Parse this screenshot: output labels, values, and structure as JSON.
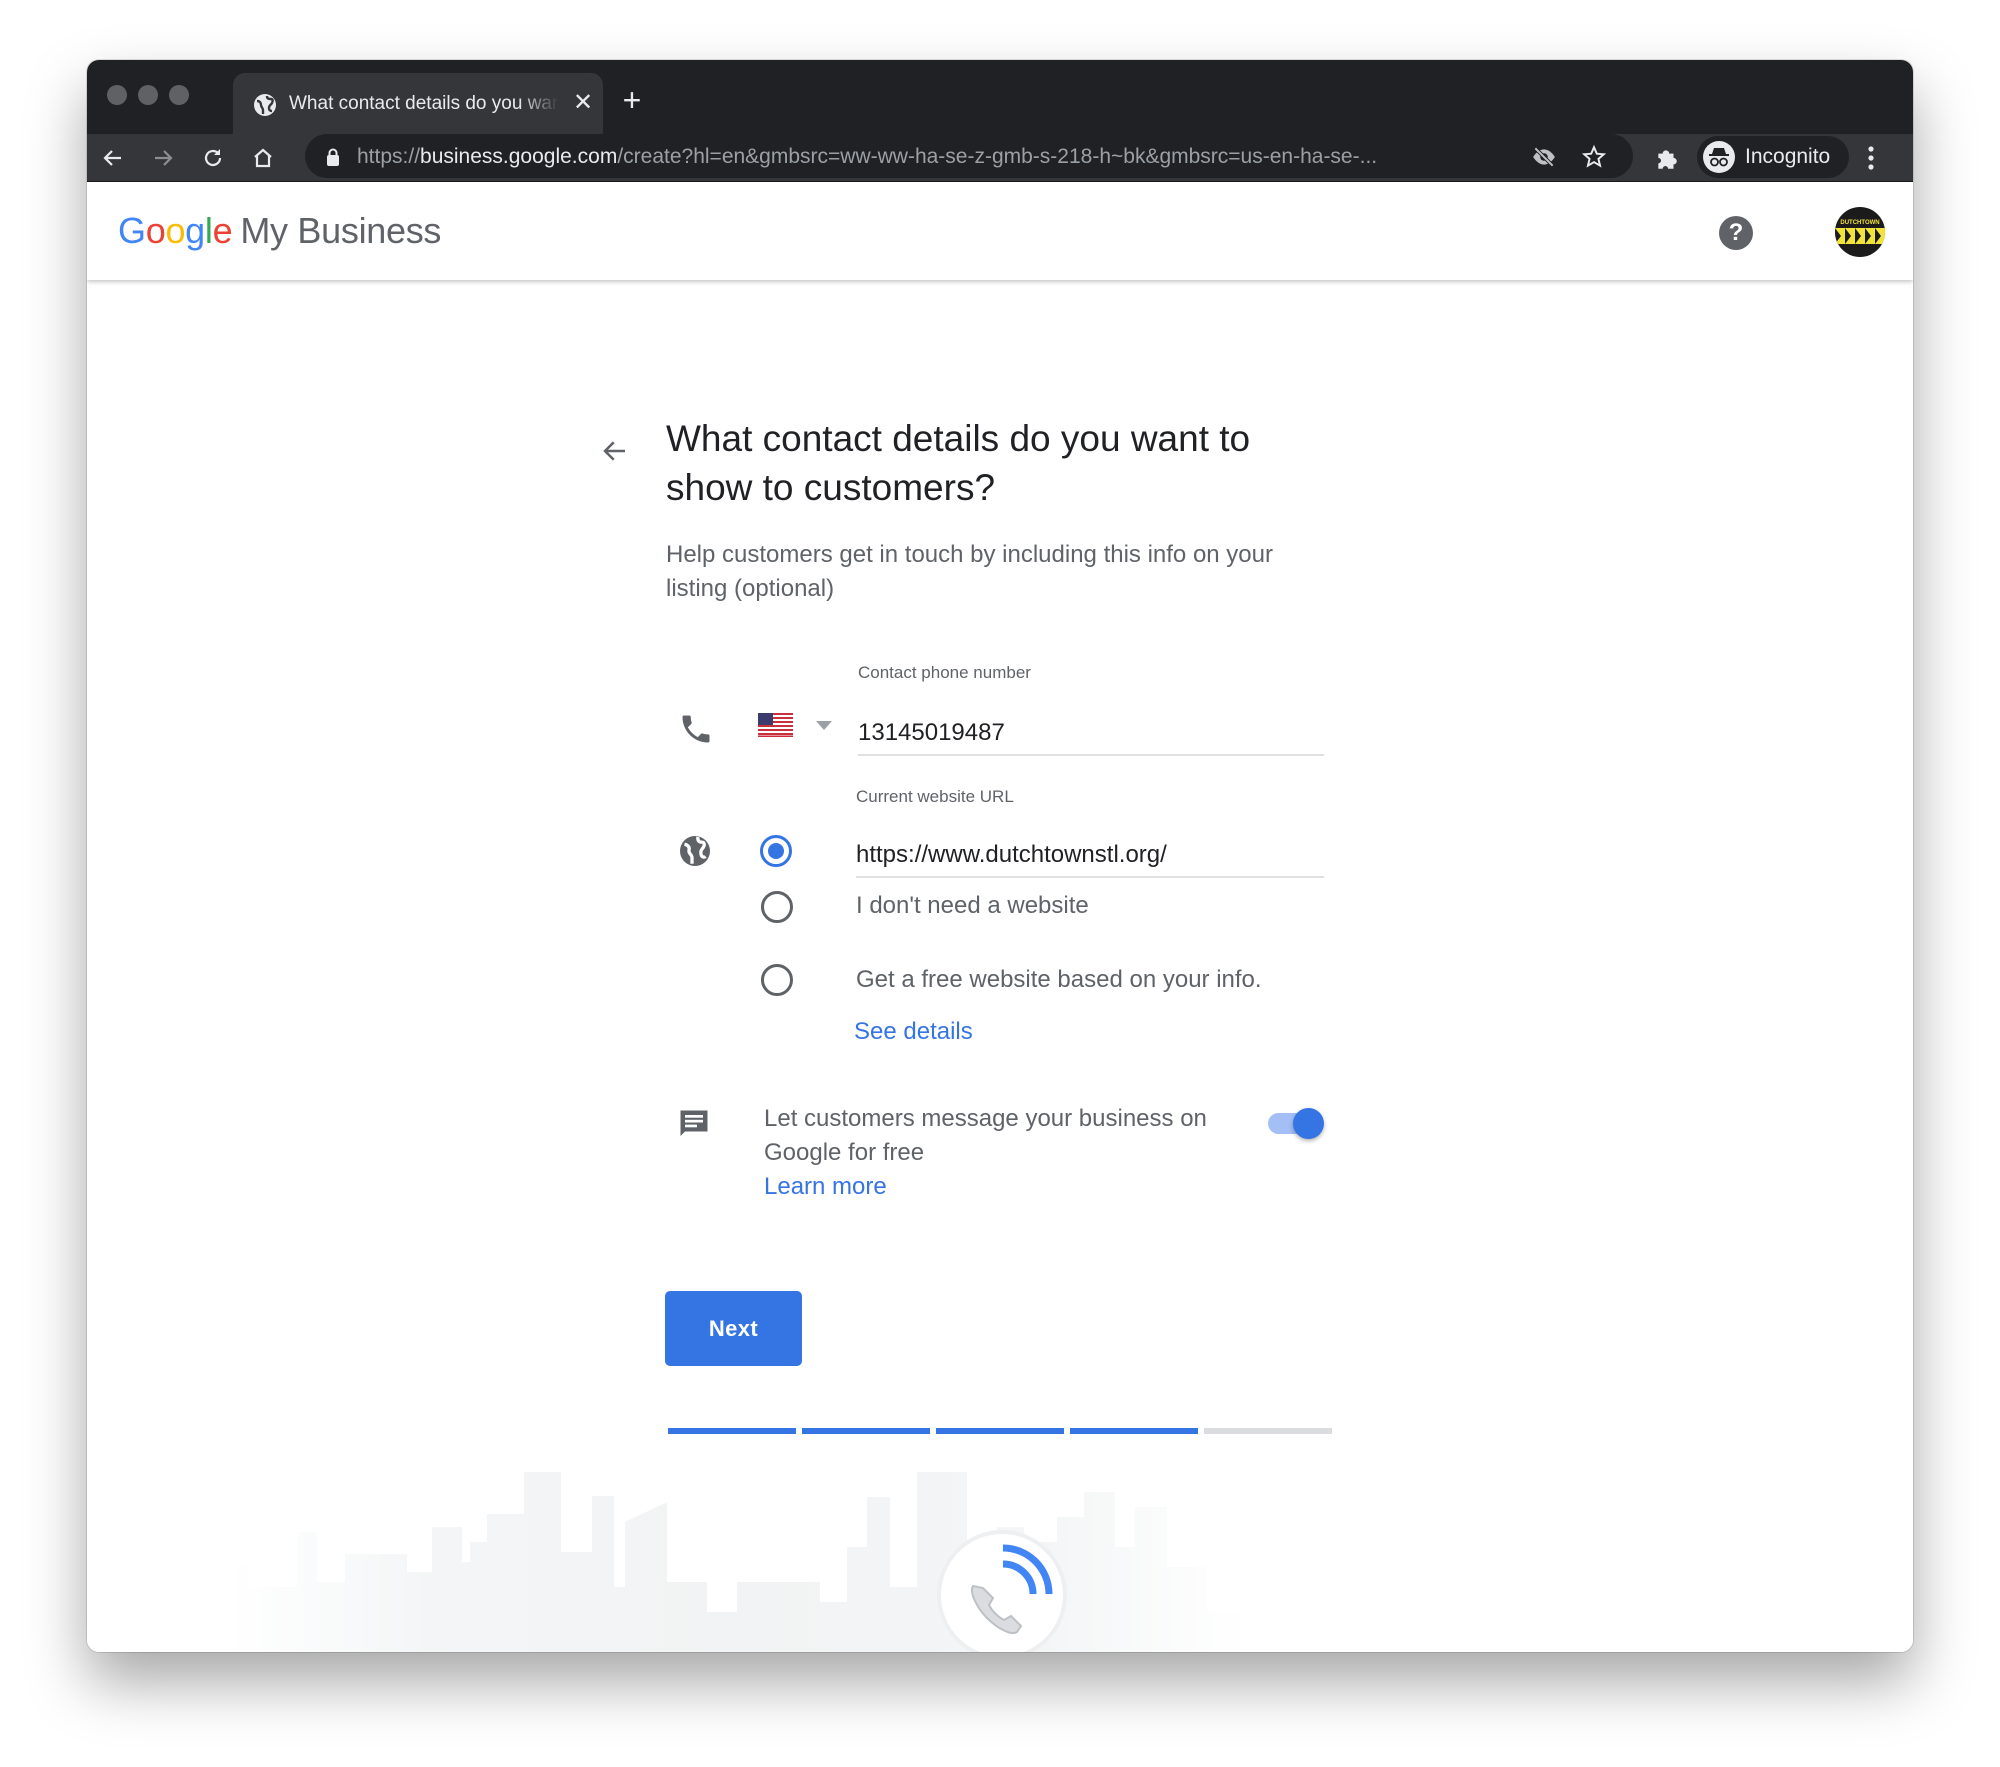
{
  "browser": {
    "tab_title": "What contact details do you want to show to customers?",
    "new_tab_label": "+",
    "close_tab_label": "✕",
    "url_scheme": "https://",
    "url_host": "business.google.com",
    "url_path": "/create?hl=en&gmbsrc=ww-ww-ha-se-z-gmb-s-218-h~bk&gmbsrc=us-en-ha-se-...",
    "profile_label": "Incognito",
    "icons": {
      "back": "arrow-left-icon",
      "forward": "arrow-right-icon",
      "reload": "reload-icon",
      "home": "home-icon",
      "lock": "lock-icon",
      "tracking": "eye-off-icon",
      "bookmark": "star-icon",
      "extensions": "puzzle-icon",
      "menu": "more-vert-icon"
    }
  },
  "header": {
    "logo_letters": [
      "G",
      "o",
      "o",
      "g",
      "l",
      "e"
    ],
    "product_name": "My Business",
    "help_label": "?",
    "account_avatar_text": "DUTCHTOWN"
  },
  "form": {
    "title": "What contact details do you want to show to customers?",
    "subtitle": "Help customers get in touch by including this info on your listing (optional)",
    "phone": {
      "label": "Contact phone number",
      "country": "US",
      "value": "13145019487"
    },
    "website": {
      "label": "Current website URL",
      "value": "https://www.dutchtownstl.org/",
      "options": [
        {
          "label": "",
          "selected": true
        },
        {
          "label": "I don't need a website",
          "selected": false
        },
        {
          "label": "Get a free website based on your info.",
          "selected": false
        }
      ],
      "see_details_link": "See details"
    },
    "messaging": {
      "text": "Let customers message your business on Google for free",
      "learn_more_link": "Learn more",
      "enabled": true
    },
    "next_button": "Next",
    "progress": {
      "completed_steps": 4,
      "total_steps": 5
    }
  },
  "colors": {
    "accent": "#3574e3",
    "text_primary": "#202124",
    "text_secondary": "#5f6368",
    "progress_inactive": "#dadce0"
  }
}
